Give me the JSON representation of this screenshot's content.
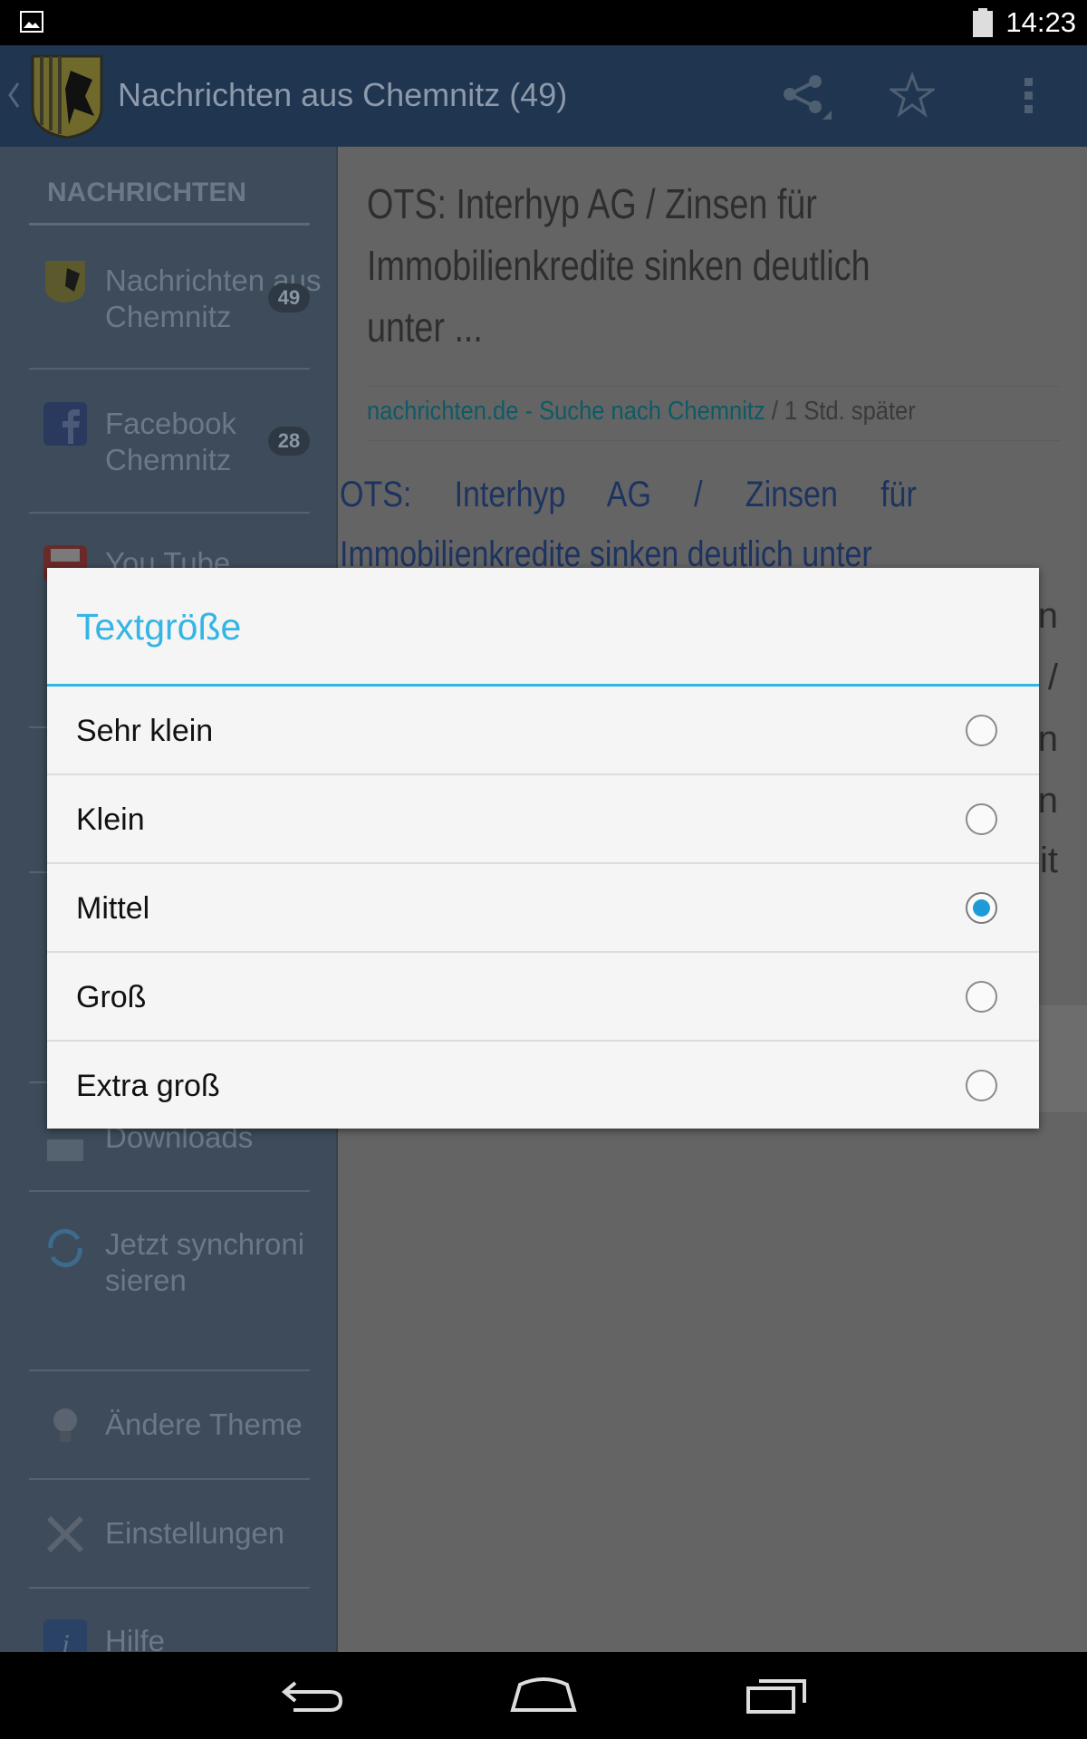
{
  "status_bar": {
    "time": "14:23",
    "notification_icon": "image-icon",
    "battery_icon": "battery-icon"
  },
  "action_bar": {
    "title": "Nachrichten aus Chemnitz (49)",
    "icons": [
      "back-chevron-icon",
      "city-crest-logo",
      "share-icon",
      "star-icon",
      "overflow-menu-icon"
    ]
  },
  "sidebar": {
    "header": "NACHRICHTEN",
    "items": [
      {
        "label": "Nachrichten aus Chemnitz",
        "badge": "49",
        "icon": "crest-icon"
      },
      {
        "label": "Facebook Chemnitz",
        "badge": "28",
        "icon": "facebook-icon"
      },
      {
        "label": "You Tube",
        "icon": "youtube-icon"
      },
      {
        "label": "Downloads",
        "icon": "download-icon"
      },
      {
        "label": "Jetzt synchronisieren",
        "icon": "sync-icon"
      },
      {
        "label": "Ändere Theme",
        "icon": "lightbulb-icon"
      },
      {
        "label": "Einstellungen",
        "icon": "tools-icon"
      },
      {
        "label": "Hilfe",
        "icon": "info-icon"
      }
    ]
  },
  "article": {
    "title_lines": [
      "OTS: Interhyp AG / Zinsen für",
      "Immobilienkredite sinken deutlich",
      "unter ..."
    ],
    "source": "nachrichten.de - Suche nach Chemnitz",
    "time": " / 1 Std. später",
    "body_lines": [
      "OTS:     Interhyp     AG     /     Zinsen     für",
      "Immobilienkredite sinken deutlich unter"
    ],
    "occluded_line_endings": [
      "n",
      "/",
      "n",
      "n",
      "it"
    ]
  },
  "dialog": {
    "title": "Textgröße",
    "options": [
      {
        "label": "Sehr klein",
        "selected": false
      },
      {
        "label": "Klein",
        "selected": false
      },
      {
        "label": "Mittel",
        "selected": true
      },
      {
        "label": "Groß",
        "selected": false
      },
      {
        "label": "Extra groß",
        "selected": false
      }
    ],
    "accent_color": "#33b5e5"
  },
  "nav_bar": {
    "icons": [
      "back-icon",
      "home-icon",
      "recent-apps-icon"
    ]
  }
}
